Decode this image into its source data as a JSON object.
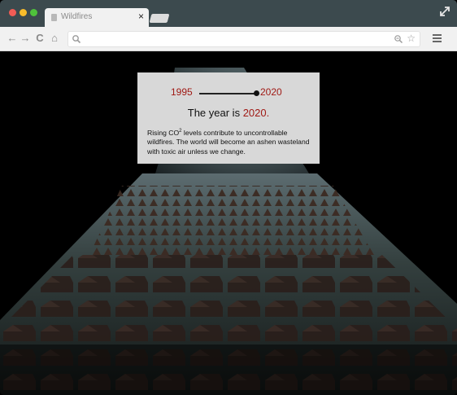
{
  "browser": {
    "tab_title": "Wildfires",
    "tab_close": "×",
    "address_value": "",
    "nav": {
      "back": "←",
      "forward": "→",
      "reload": "C",
      "home": "⌂"
    },
    "star": "☆"
  },
  "slider": {
    "start_year": "1995",
    "end_year": "2020",
    "value_fraction": 1.0
  },
  "headline": {
    "prefix": "The year is ",
    "year": "2020."
  },
  "description": {
    "pre": "Rising CO",
    "sup": "2",
    "post": " levels contribute to uncontrollable wildfires. The world will become an ashen wasteland with toxic air unless we change."
  },
  "colors": {
    "accent": "#a01a15",
    "titlebar": "#3c4a4e",
    "panel": "#d8d8d8"
  }
}
